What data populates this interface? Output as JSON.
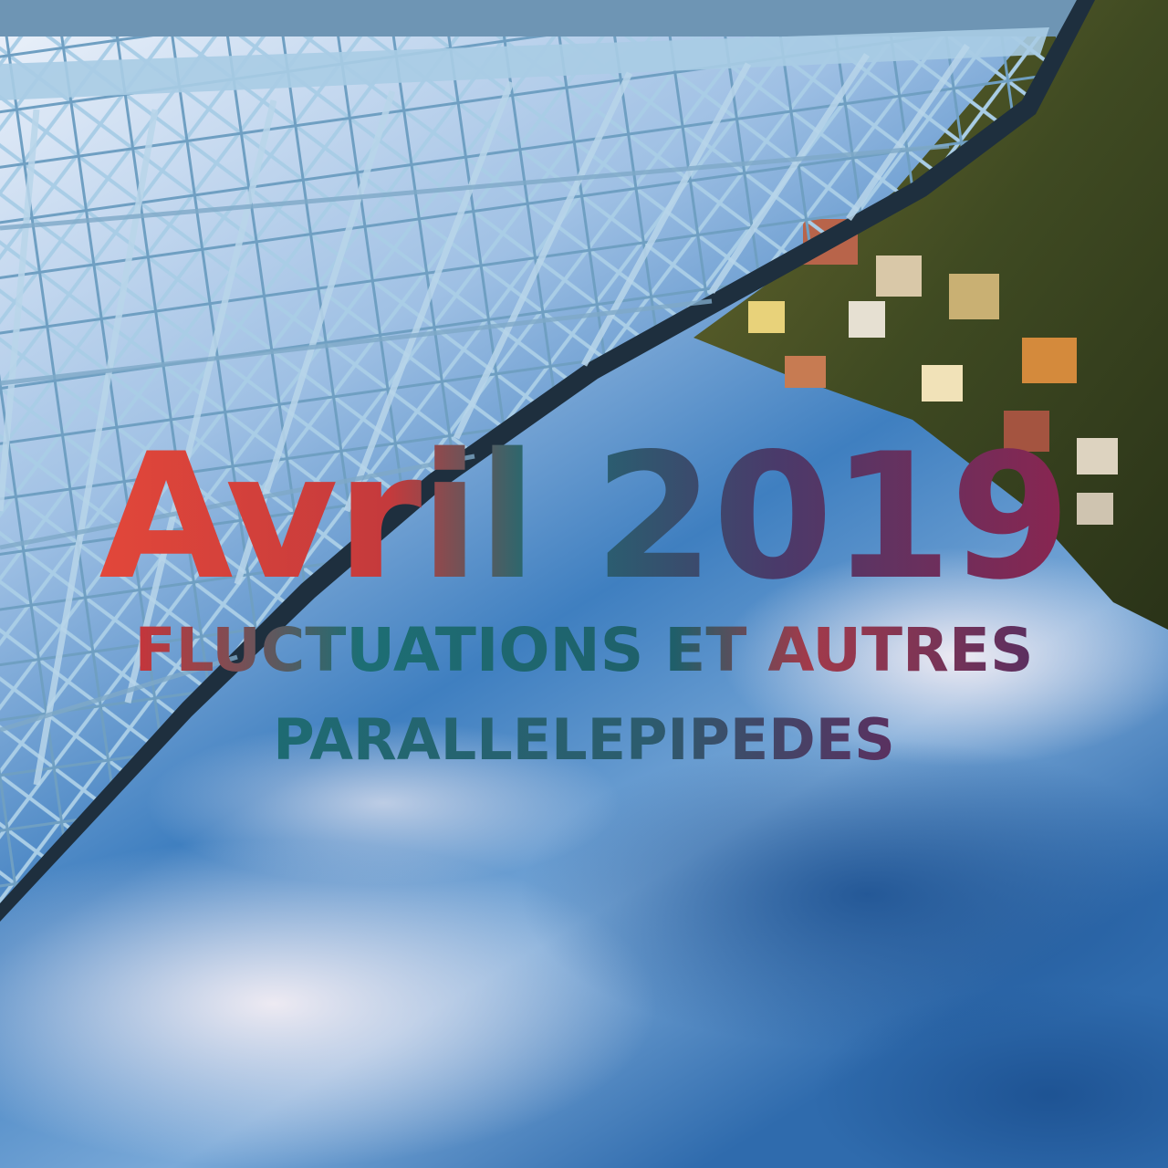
{
  "poster": {
    "title": "Avril 2019",
    "subtitle_line1": "FLUCTUATIONS ET AUTRES",
    "subtitle_line2": "PARALLELEPIPEDES"
  },
  "colors": {
    "sky_top": "#dfe9f6",
    "sky_mid": "#7aa6d6",
    "sky_deep": "#1f5f9e",
    "steel": "#9cc3df",
    "steel_dark": "#23384a",
    "foliage": "#4b5a26",
    "text_red": "#e2473a",
    "text_teal": "#1e6b72",
    "text_plum": "#7a2a55"
  }
}
